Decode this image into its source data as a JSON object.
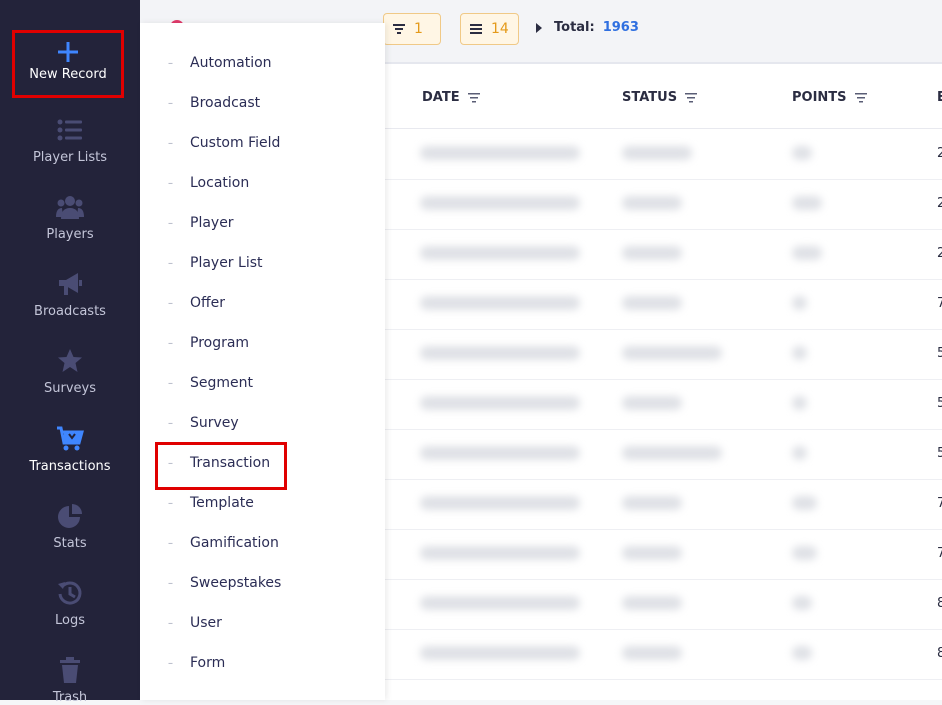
{
  "sidebar": {
    "new_record_label": "New Record",
    "items": [
      {
        "label": "Player Lists",
        "icon": "list-icon"
      },
      {
        "label": "Players",
        "icon": "users-icon"
      },
      {
        "label": "Broadcasts",
        "icon": "megaphone-icon"
      },
      {
        "label": "Surveys",
        "icon": "star-icon"
      },
      {
        "label": "Transactions",
        "icon": "cart-icon",
        "active": true
      },
      {
        "label": "Stats",
        "icon": "pie-chart-icon"
      },
      {
        "label": "Logs",
        "icon": "history-icon"
      },
      {
        "label": "Trash",
        "icon": "trash-icon"
      }
    ]
  },
  "toolbar": {
    "filter_count": "1",
    "columns_count": "14",
    "total_label": "Total:",
    "total_value": "1963"
  },
  "table": {
    "columns": [
      "DATE",
      "STATUS",
      "POINTS"
    ],
    "cut_off_column_initial": "E",
    "cut_off_values": [
      "2",
      "2",
      "2",
      "7",
      "5",
      "5",
      "5",
      "7",
      "7",
      "8",
      "8"
    ]
  },
  "menu": {
    "items": [
      "Automation",
      "Broadcast",
      "Custom Field",
      "Location",
      "Player",
      "Player List",
      "Offer",
      "Program",
      "Segment",
      "Survey",
      "Transaction",
      "Template",
      "Gamification",
      "Sweepstakes",
      "User",
      "Form"
    ],
    "highlighted": "Transaction"
  },
  "colors": {
    "sidebar_bg": "#23233a",
    "accent_blue": "#2f6fe0",
    "chip_orange": "#e49a1a",
    "highlight_red": "#e00000"
  }
}
